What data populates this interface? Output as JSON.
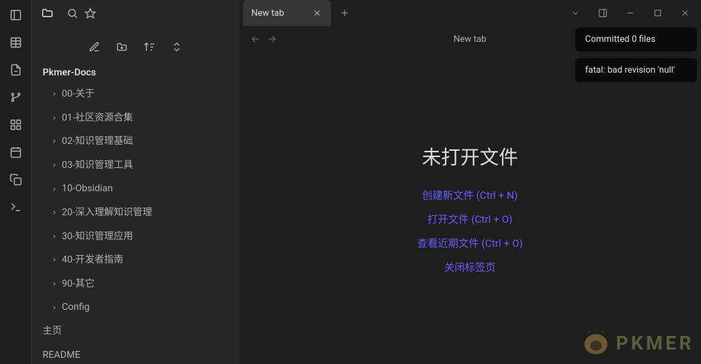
{
  "sidebar": {
    "vault_name": "Pkmer-Docs",
    "folders": [
      "00-关于",
      "01-社区资源合集",
      "02-知识管理基础",
      "03-知识管理工具",
      "10-Obsidian",
      "20-深入理解知识管理",
      "30-知识管理应用",
      "40-开发者指南",
      "90-其它",
      "Config"
    ],
    "files": [
      "主页",
      "README"
    ]
  },
  "tab": {
    "title": "New tab"
  },
  "subheader": {
    "title": "New tab"
  },
  "empty": {
    "title": "未打开文件",
    "actions": [
      "创建新文件 (Ctrl + N)",
      "打开文件 (Ctrl + O)",
      "查看近期文件 (Ctrl + O)",
      "关闭标签页"
    ]
  },
  "toasts": [
    "Committed 0 files",
    "fatal: bad revision 'null'"
  ],
  "logo": {
    "wordmark": "PKMER"
  }
}
